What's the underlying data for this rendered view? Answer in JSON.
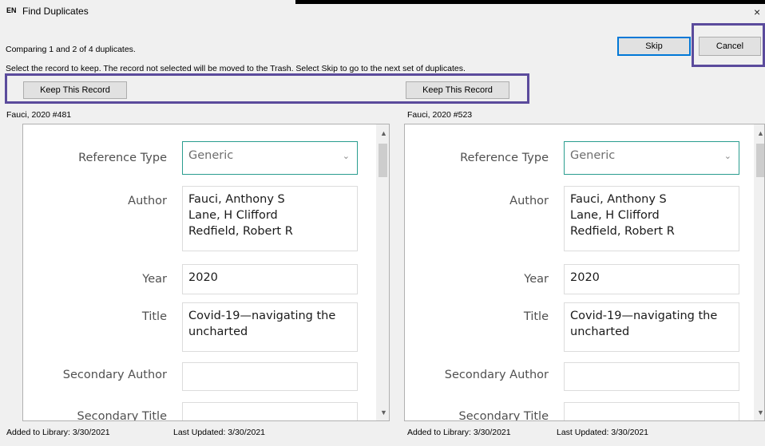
{
  "window": {
    "lang_badge": "EN",
    "title": "Find Duplicates",
    "close_glyph": "×"
  },
  "header": {
    "comparing_text": "Comparing 1 and 2 of 4 duplicates.",
    "instructions": "Select the record to keep. The record not selected will be moved to the Trash. Select Skip to go to the next set of duplicates.",
    "skip_label": "Skip",
    "cancel_label": "Cancel"
  },
  "left": {
    "keep_label": "Keep This Record",
    "record_id": "Fauci, 2020 #481",
    "reference_type_label": "Reference Type",
    "reference_type_value": "Generic",
    "author_label": "Author",
    "authors": [
      "Fauci, Anthony S",
      "Lane, H Clifford",
      "Redfield, Robert R"
    ],
    "year_label": "Year",
    "year_value": "2020",
    "title_label": "Title",
    "title_lines": [
      "Covid-19—navigating the",
      "uncharted"
    ],
    "secondary_author_label": "Secondary Author",
    "secondary_author_value": "",
    "secondary_title_label": "Secondary Title",
    "added": "Added to Library: 3/30/2021",
    "updated": "Last Updated: 3/30/2021"
  },
  "right": {
    "keep_label": "Keep This Record",
    "record_id": "Fauci, 2020 #523",
    "reference_type_label": "Reference Type",
    "reference_type_value": "Generic",
    "author_label": "Author",
    "authors": [
      "Fauci, Anthony S",
      "Lane, H Clifford",
      "Redfield, Robert R"
    ],
    "year_label": "Year",
    "year_value": "2020",
    "title_label": "Title",
    "title_lines": [
      "Covid-19—navigating the",
      "uncharted"
    ],
    "secondary_author_label": "Secondary Author",
    "secondary_author_value": "",
    "secondary_title_label": "Secondary Title",
    "added": "Added to Library: 3/30/2021",
    "updated": "Last Updated: 3/30/2021"
  },
  "icons": {
    "dropdown": "chevron-down-icon",
    "scroll_up": "arrow-up-icon",
    "scroll_down": "arrow-down-icon",
    "close": "close-icon"
  },
  "colors": {
    "highlight": "#5b4b9c",
    "select_border": "#2a9d8f",
    "primary_button_border": "#0078d7"
  }
}
